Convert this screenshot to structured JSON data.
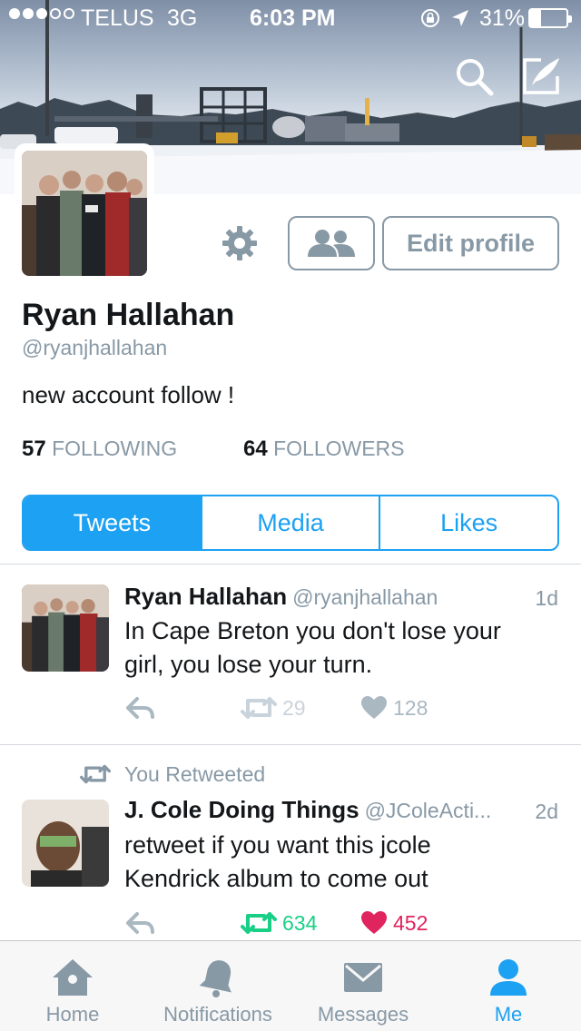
{
  "status_bar": {
    "carrier": "TELUS",
    "network": "3G",
    "time": "6:03 PM",
    "battery": "31%",
    "battery_level": 0.31
  },
  "header": {
    "icons": [
      "search-icon",
      "compose-icon"
    ]
  },
  "profile": {
    "name": "Ryan Hallahan",
    "handle": "@ryanjhallahan",
    "bio": "new account follow !",
    "following_count": "57",
    "following_label": "FOLLOWING",
    "followers_count": "64",
    "followers_label": "FOLLOWERS",
    "edit_label": "Edit profile"
  },
  "tabs": [
    {
      "label": "Tweets",
      "active": true
    },
    {
      "label": "Media",
      "active": false
    },
    {
      "label": "Likes",
      "active": false
    }
  ],
  "tweets": [
    {
      "name": "Ryan Hallahan",
      "handle": "@ryanjhallahan",
      "time": "1d",
      "text_lines": [
        "In Cape Breton you don't lose your",
        "girl, you lose your turn."
      ],
      "retweets": "29",
      "likes": "128",
      "retweeted": false,
      "liked": false
    },
    {
      "retweet_label": "You Retweeted",
      "name": "J. Cole Doing Things",
      "handle": "@JColeActi...",
      "time": "2d",
      "text_lines": [
        "retweet if you want this jcole",
        "Kendrick album to come out"
      ],
      "retweets": "634",
      "likes": "452",
      "retweeted": true,
      "liked": true
    }
  ],
  "tab_bar": [
    {
      "label": "Home",
      "icon": "home-icon",
      "active": false
    },
    {
      "label": "Notifications",
      "icon": "bell-icon",
      "active": false
    },
    {
      "label": "Messages",
      "icon": "envelope-icon",
      "active": false
    },
    {
      "label": "Me",
      "icon": "person-icon",
      "active": true
    }
  ],
  "colors": {
    "accent": "#1da1f2",
    "muted": "#8899a6",
    "retweet_green": "#19cf86",
    "like_red": "#e0245e"
  }
}
